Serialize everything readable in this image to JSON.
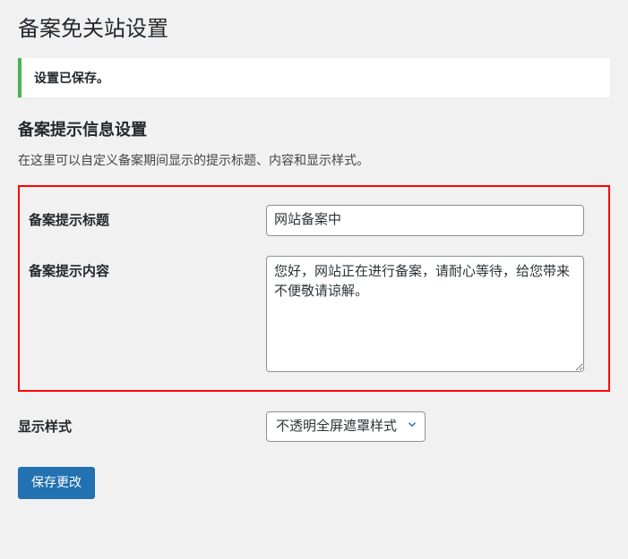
{
  "page": {
    "title": "备案免关站设置"
  },
  "notice": {
    "message": "设置已保存。"
  },
  "section": {
    "title": "备案提示信息设置",
    "description": "在这里可以自定义备案期间显示的提示标题、内容和显示样式。"
  },
  "form": {
    "titleField": {
      "label": "备案提示标题",
      "value": "网站备案中"
    },
    "contentField": {
      "label": "备案提示内容",
      "value": "您好，网站正在进行备案，请耐心等待，给您带来不便敬请谅解。"
    },
    "styleField": {
      "label": "显示样式",
      "selected": "不透明全屏遮罩样式"
    },
    "submitLabel": "保存更改"
  }
}
